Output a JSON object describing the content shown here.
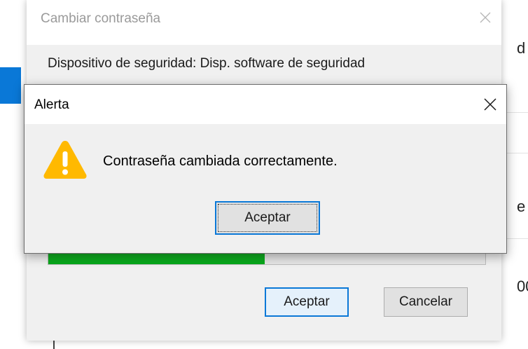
{
  "background_window": {
    "fragments": [
      "d",
      "e",
      "00"
    ]
  },
  "change_password_dialog": {
    "title": "Cambiar contraseña",
    "security_device_text": "Dispositivo de seguridad: Disp. software de seguridad",
    "password_quality_progress": 0.495,
    "ok_label": "Aceptar",
    "cancel_label": "Cancelar"
  },
  "alert_dialog": {
    "title": "Alerta",
    "message": "Contraseña cambiada correctamente.",
    "ok_label": "Aceptar",
    "icon": "warning-icon"
  },
  "colors": {
    "accent": "#0a78d7",
    "progress": "#06a91b",
    "warning": "#ffb900"
  }
}
